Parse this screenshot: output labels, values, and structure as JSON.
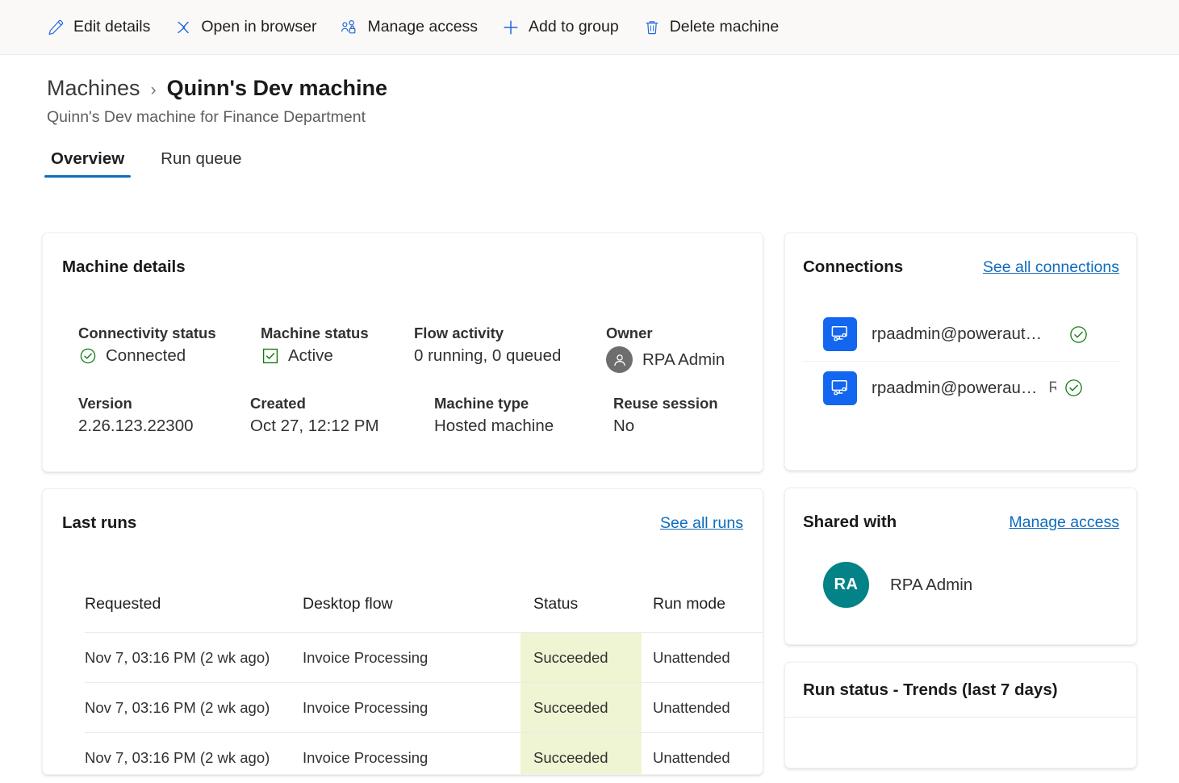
{
  "commandbar": {
    "items": [
      {
        "icon": "edit-pencil-icon",
        "label": "Edit details"
      },
      {
        "icon": "open-in-browser-icon",
        "label": "Open in browser"
      },
      {
        "icon": "manage-access-icon",
        "label": "Manage access"
      },
      {
        "icon": "add-plus-icon",
        "label": "Add to group"
      },
      {
        "icon": "delete-trash-icon",
        "label": "Delete machine"
      }
    ]
  },
  "breadcrumb": {
    "parent": "Machines",
    "separator": "›",
    "current": "Quinn's Dev machine"
  },
  "subtitle": "Quinn's Dev machine for Finance Department",
  "tabs": [
    {
      "label": "Overview",
      "active": true
    },
    {
      "label": "Run queue",
      "active": false
    }
  ],
  "machine_details": {
    "title": "Machine details",
    "fields": {
      "connectivity_status": {
        "label": "Connectivity status",
        "value": "Connected",
        "icon": "green-circle-check-icon"
      },
      "machine_status": {
        "label": "Machine status",
        "value": "Active",
        "icon": "green-checkbox-icon"
      },
      "flow_activity": {
        "label": "Flow activity",
        "value": "0 running, 0 queued"
      },
      "owner": {
        "label": "Owner",
        "value": "RPA Admin",
        "icon": "person-avatar-icon"
      },
      "version": {
        "label": "Version",
        "value": "2.26.123.22300"
      },
      "created": {
        "label": "Created",
        "value": "Oct 27, 12:12 PM"
      },
      "machine_type": {
        "label": "Machine type",
        "value": "Hosted machine"
      },
      "reuse_session": {
        "label": "Reuse session",
        "value": "No"
      }
    }
  },
  "last_runs": {
    "title": "Last runs",
    "see_all_label": "See all runs",
    "columns": [
      "Requested",
      "Desktop flow",
      "Status",
      "Run mode"
    ],
    "rows": [
      {
        "requested": "Nov 7, 03:16 PM (2 wk ago)",
        "flow": "Invoice Processing",
        "status": "Succeeded",
        "run_mode": "Unattended"
      },
      {
        "requested": "Nov 7, 03:16 PM (2 wk ago)",
        "flow": "Invoice Processing",
        "status": "Succeeded",
        "run_mode": "Unattended"
      },
      {
        "requested": "Nov 7, 03:16 PM (2 wk ago)",
        "flow": "Invoice Processing",
        "status": "Succeeded",
        "run_mode": "Unattended"
      }
    ]
  },
  "connections": {
    "title": "Connections",
    "see_all_label": "See all connections",
    "items": [
      {
        "name": "rpaadmin@poweraut…",
        "owner": "",
        "status_icon": "green-circle-check-icon",
        "tile_icon": "desktop-flow-icon"
      },
      {
        "name": "rpaadmin@powerau…",
        "owner": "R",
        "status_icon": "green-circle-check-icon",
        "tile_icon": "desktop-flow-icon"
      }
    ]
  },
  "shared_with": {
    "title": "Shared with",
    "manage_access_label": "Manage access",
    "people": [
      {
        "initials": "RA",
        "name": "RPA Admin"
      }
    ]
  },
  "trends": {
    "title": "Run status - Trends (last 7 days)"
  },
  "colors": {
    "accent": "#0f6cbd",
    "link": "#0f6cbd",
    "success_bg": "#eff4d3",
    "green": "#107c10",
    "tile_blue": "#1366f0",
    "avatar_teal": "#038387",
    "commandbar_bg": "#faf9f8"
  }
}
